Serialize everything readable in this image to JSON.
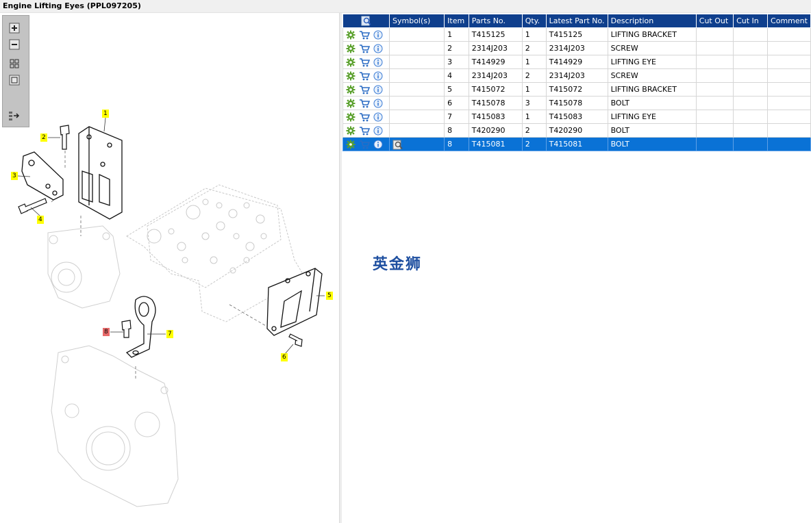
{
  "window": {
    "title": "Engine Lifting Eyes (PPL097205)"
  },
  "toolbar": {
    "tools": [
      {
        "name": "zoom-in-icon"
      },
      {
        "name": "zoom-out-icon"
      },
      {
        "name": "fit-all-icon"
      },
      {
        "name": "actual-size-icon"
      },
      {
        "name": "list-arrow-icon"
      }
    ]
  },
  "callouts": [
    {
      "label": "1",
      "highlight": "yellow"
    },
    {
      "label": "2",
      "highlight": "yellow"
    },
    {
      "label": "3",
      "highlight": "yellow"
    },
    {
      "label": "4",
      "highlight": "yellow"
    },
    {
      "label": "5",
      "highlight": "yellow"
    },
    {
      "label": "6",
      "highlight": "yellow"
    },
    {
      "label": "7",
      "highlight": "yellow"
    },
    {
      "label": "8",
      "highlight": "red"
    }
  ],
  "watermark": "英金狮",
  "grid": {
    "columns": [
      "Symbol(s)",
      "Item",
      "Parts No.",
      "Qty.",
      "Latest Part No.",
      "Description",
      "Cut Out",
      "Cut In",
      "Comment"
    ],
    "rows": [
      {
        "symbol": "",
        "item": "1",
        "part_no": "T415125",
        "qty": "1",
        "latest": "T415125",
        "desc": "LIFTING BRACKET",
        "cut_out": "",
        "cut_in": "",
        "comment": ""
      },
      {
        "symbol": "",
        "item": "2",
        "part_no": "2314J203",
        "qty": "2",
        "latest": "2314J203",
        "desc": "SCREW",
        "cut_out": "",
        "cut_in": "",
        "comment": ""
      },
      {
        "symbol": "",
        "item": "3",
        "part_no": "T414929",
        "qty": "1",
        "latest": "T414929",
        "desc": "LIFTING EYE",
        "cut_out": "",
        "cut_in": "",
        "comment": ""
      },
      {
        "symbol": "",
        "item": "4",
        "part_no": "2314J203",
        "qty": "2",
        "latest": "2314J203",
        "desc": "SCREW",
        "cut_out": "",
        "cut_in": "",
        "comment": ""
      },
      {
        "symbol": "",
        "item": "5",
        "part_no": "T415072",
        "qty": "1",
        "latest": "T415072",
        "desc": "LIFTING BRACKET",
        "cut_out": "",
        "cut_in": "",
        "comment": ""
      },
      {
        "symbol": "",
        "item": "6",
        "part_no": "T415078",
        "qty": "3",
        "latest": "T415078",
        "desc": "BOLT",
        "cut_out": "",
        "cut_in": "",
        "comment": ""
      },
      {
        "symbol": "",
        "item": "7",
        "part_no": "T415083",
        "qty": "1",
        "latest": "T415083",
        "desc": "LIFTING EYE",
        "cut_out": "",
        "cut_in": "",
        "comment": ""
      },
      {
        "symbol": "",
        "item": "8",
        "part_no": "T420290",
        "qty": "2",
        "latest": "T420290",
        "desc": "BOLT",
        "cut_out": "",
        "cut_in": "",
        "comment": ""
      },
      {
        "symbol": "search-doc-icon",
        "item": "8",
        "part_no": "T415081",
        "qty": "2",
        "latest": "T415081",
        "desc": "BOLT",
        "cut_out": "",
        "cut_in": "",
        "comment": "",
        "selected": true
      }
    ],
    "row_actions": [
      "gear-icon",
      "cart-icon",
      "info-icon"
    ]
  },
  "colors": {
    "header_bg": "#0f3f8d",
    "selected_row": "#0a72d6",
    "callout": "#ffff00",
    "callout_alt": "#e86a6a"
  }
}
